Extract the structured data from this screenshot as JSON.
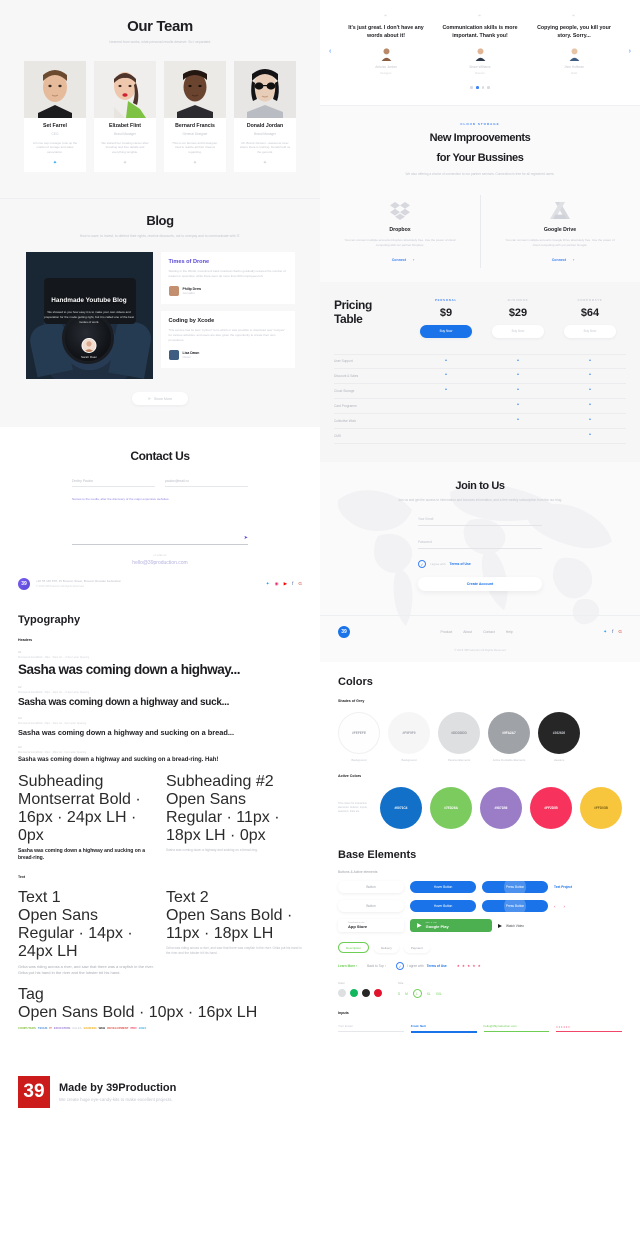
{
  "team": {
    "title": "Our Team",
    "subtitle": "I learned from works, what personal results\ndeserve. So I separated.",
    "members": [
      {
        "name": "Set Farrel",
        "role": "CEO",
        "desc": "A home cap manager took up the market of storage and sales association.",
        "social": "twitter-icon"
      },
      {
        "name": "Elizabet Flint",
        "role": "Brand Manager",
        "desc": "We started her creating career after founding and free details and everything tangible.",
        "social": "twitter-icon"
      },
      {
        "name": "Bernard Francis",
        "role": "General Designer",
        "desc": "This is our famous archit designer, tried to realize all their dreams regarding.",
        "social": "twitter-icon"
      },
      {
        "name": "Donald Jordan",
        "role": "Brand Manager",
        "desc": "Mr. Brand Jonston - awesome lover where there is training. Donald told us the general.",
        "social": "twitter-icon"
      }
    ]
  },
  "blog": {
    "title": "Blog",
    "subtitle": "How to save, to invest, to defend their\nrights, receive discounts, not to overpay\nand to communicate with IT.",
    "hero": {
      "title": "Handmade Youtube Blog",
      "desc": "We showed to you how easy it is to make your own videos and preparation for the mode getting right, but it is called one of the best modes of work.",
      "author": "Sarah Roan"
    },
    "posts": [
      {
        "title": "Times of Drone",
        "body": "Starting in the 2010s, investment bank Goldman Sachs gradually reduced the number of traders in securities, while there were de more than 600 employees left.",
        "author": "Philip Drew",
        "role": "Journalist"
      },
      {
        "title": "Coding by Xcode",
        "body": "This service has its best \"python\" form which in was possible to download new \"recipes\" for various activities, and users are also given the opportunity to create their own procedures.",
        "author": "Lisa Dawn",
        "role": "Owner"
      }
    ],
    "show_more": "Show More"
  },
  "contact": {
    "title": "Contact Us",
    "name_value": "Dmitry Paulov",
    "email_value": "paulov@mail.ru",
    "note": "Names to the media, after the discovery of the major expensive websites.",
    "message_placeholder": "",
    "send_icon": "send-icon",
    "or": "or write us",
    "email_link": "hello@39production.com",
    "address_line1": "+40 55 145 878, 15 Brooton Street, Brooton Russian Federation",
    "address_line2": "© 2018 39Production All Rights Reserved",
    "socials": [
      "twitter-icon",
      "instagram-icon",
      "youtube-icon",
      "facebook-icon",
      "google-plus-icon"
    ],
    "logo": "39"
  },
  "typography": {
    "title": "Typography",
    "headers_label": "Headers",
    "items": [
      {
        "tag": "H1",
        "meta": "Montserrat ExtraBold · 48px · 54px LH · -0.5px Letter Spacing",
        "text": "Sasha was coming down a highway...",
        "size": "h1s"
      },
      {
        "tag": "H2",
        "meta": "Montserrat ExtraBold · 36px · 44px LH · -0.3px Letter Spacing",
        "text": "Sasha was coming down a highway and suck...",
        "size": "h2s"
      },
      {
        "tag": "H3",
        "meta": "Montserrat ExtraBold · 26px · 34px LH · 0px Letter Spacing",
        "text": "Sasha was coming down a highway and sucking on a bread...",
        "size": "h3s"
      },
      {
        "tag": "H4",
        "meta": "Montserrat ExtraBold · 20px · 28px LH · 0px Letter Spacing",
        "text": "Sasha was coming down a highway and sucking on a bread-ring. Hah!",
        "size": "h4s"
      }
    ],
    "sub_left": {
      "label": "Subheading",
      "meta": "Montserrat Bold · 16px · 24px LH · 0px",
      "text": "Sasha was coming down a highway and sucking on a bread-ring."
    },
    "sub_right": {
      "label": "Subheading #2",
      "meta": "Open Sans Regular · 11px · 18px LH · 0px",
      "text": "Sasha was coming down a highway and sucking on a bread-ring."
    },
    "text_label": "Text",
    "text_left": {
      "label": "Text 1",
      "meta": "Open Sans Regular · 14px · 24px LH",
      "body": "Grika was riding across a river, and saw that there was a crayfish in the river. Grika put his hand in the river and the lobster bit his hand."
    },
    "text_right": {
      "label": "Text 2",
      "meta": "Open Sans Bold · 11px · 18px LH",
      "body": "Grika was riding across a river, and saw that there was crayfish in the river. Grika put his hand in the river and the lobster bit his hand."
    },
    "tag_label": "Tag",
    "tag_meta": "Open Sans Bold · 10px · 16px LH",
    "tags": [
      {
        "t": "COMPUTERS",
        "c": "#8bc34a"
      },
      {
        "t": "TECHS",
        "c": "#4a90d9"
      },
      {
        "t": "IT",
        "c": "#e2574c"
      },
      {
        "t": "EDUCATION",
        "c": "#9b7fd4"
      },
      {
        "t": "SALES",
        "c": "#cfd2d8"
      },
      {
        "t": "BANKING",
        "c": "#f0b429"
      },
      {
        "t": "WEB",
        "c": "#3a3a3a"
      },
      {
        "t": "DEVELOPMENT",
        "c": "#e2574c"
      },
      {
        "t": "PRO",
        "c": "#f2456a"
      },
      {
        "t": "JOBS",
        "c": "#4ab8e8"
      }
    ]
  },
  "madeby": {
    "logo": "39",
    "title": "Made by 39Production",
    "subtitle": "We create huge eye-candy-kits to make excellent projects."
  },
  "testimonials": {
    "prev_icon": "chevron-left-icon",
    "next_icon": "chevron-right-icon",
    "items": [
      {
        "quote": "It's just great. I don't have any words about it!",
        "name": "Antonio Jordan",
        "role": "Designer"
      },
      {
        "quote": "Communication skills is more important. Thank you!",
        "name": "Bruce Williams",
        "role": "Director"
      },
      {
        "quote": "Copying people, you kill your story. Sorry...",
        "name": "Jhon Hoffman",
        "role": "Artist"
      }
    ],
    "dots": [
      false,
      true,
      false,
      false
    ]
  },
  "cloud": {
    "eyebrow": "CLOUD STORAGE",
    "title_line1": "New Improovements",
    "title_line2": "for Your Bussines",
    "subtitle": "We also offering a choice of connection\nto our partner services. Connection is free\nfor all registered users.",
    "cards": [
      {
        "icon": "dropbox-icon",
        "title": "Dropbox",
        "desc": "You can connect multiple accounts Dropbox absolutely free. Use the power of cloud computing with our partner Dropbox.",
        "cta": "Connect",
        "cta_icon": "arrow-right-icon"
      },
      {
        "icon": "google-drive-icon",
        "title": "Google Drive",
        "desc": "You can connect multiple accounts Google Drive absolutely free. Use the power of cloud computing with our partner Google.",
        "cta": "Connect",
        "cta_icon": "arrow-right-icon"
      }
    ]
  },
  "pricing": {
    "title_line1": "Pricing",
    "title_line2": "Table",
    "plans": [
      {
        "tier": "PERSONAL",
        "price": "$9",
        "cta": "Buy Now",
        "active": true
      },
      {
        "tier": "BUSINESS",
        "price": "$29",
        "cta": "Buy Now",
        "active": false
      },
      {
        "tier": "CORPORATE",
        "price": "$64",
        "cta": "Buy Now",
        "active": false
      }
    ],
    "features": [
      {
        "name": "User Support",
        "cells": [
          true,
          true,
          true
        ]
      },
      {
        "name": "Discount & Sales",
        "cells": [
          true,
          true,
          true
        ]
      },
      {
        "name": "Cloud Storage",
        "cells": [
          true,
          true,
          true
        ]
      },
      {
        "name": "Card Programm",
        "cells": [
          false,
          true,
          true
        ]
      },
      {
        "name": "Collective Work",
        "cells": [
          false,
          true,
          true
        ]
      },
      {
        "name": "CMS",
        "cells": [
          false,
          false,
          true
        ]
      }
    ]
  },
  "join": {
    "title": "Join to Us",
    "subtitle": "Join us and get the access to information and\nbonuses information, and a free weekly subscription\nfrom the our blog.",
    "email_placeholder": "Your Email",
    "password_placeholder": "Password",
    "agree_text": "I agree with",
    "terms_link": "Terms of Use",
    "submit": "Create Account",
    "logo": "39",
    "nav": [
      "Product",
      "About",
      "Contact",
      "Help"
    ],
    "socials": [
      "twitter-icon",
      "facebook-icon",
      "google-plus-icon"
    ],
    "copyright": "© 2018 39Production All Rights Reserved"
  },
  "colors": {
    "title": "Colors",
    "grey_label": "Shades of Grey",
    "greys": [
      {
        "hex": "#FEFEFE",
        "cap": "Background",
        "bg": "#fefefe",
        "fg": "#9ea1a9",
        "border": true
      },
      {
        "hex": "#F9F9F9",
        "cap": "Background",
        "bg": "#f6f6f7",
        "fg": "#9ea1a9",
        "border": false
      },
      {
        "hex": "#DDDDDD",
        "cap": "Passive Elements",
        "bg": "#dedfe1",
        "fg": "#8b8e95",
        "border": false
      },
      {
        "hex": "#9FA2A7",
        "cap": "Active Dockable Elements",
        "bg": "#9fa2a7",
        "fg": "#ffffff",
        "border": false
      },
      {
        "hex": "#262626",
        "cap": "Headers",
        "bg": "#262626",
        "fg": "#c9ccd3",
        "border": false
      }
    ],
    "active_label": "Active Colors",
    "active_note": "This colors for interactive elements: buttons, inputs, selectors, links etc.",
    "actives": [
      {
        "hex": "#0071C4",
        "bg": "#1270c9"
      },
      {
        "hex": "#7ED26A",
        "bg": "#7ccb5f"
      },
      {
        "hex": "#9871B6",
        "bg": "#9a7cc7"
      },
      {
        "hex": "#FF2D55",
        "bg": "#f7335d"
      },
      {
        "hex": "#FFD03B",
        "bg": "#f7c63c"
      }
    ]
  },
  "base": {
    "title": "Base Elements",
    "buttons_label": "Buttons & Active elements",
    "row1": {
      "b1": "Button",
      "b2": "Hover Button",
      "b3": "Press Button",
      "link": "Text Project"
    },
    "row2": {
      "b1": "Button",
      "b2": "Hover Button",
      "b3": "Press Button",
      "prev": "chevron-left-icon",
      "next": "chevron-right-icon"
    },
    "appstore": {
      "small": "Download on the",
      "big": "App Store",
      "icon": "apple-icon"
    },
    "googleplay": {
      "small": "GET IT ON",
      "big": "Google Play",
      "icon": "play-icon"
    },
    "watch": {
      "label": "Watch Video",
      "icon": "play-triangle-icon"
    },
    "tabs": [
      {
        "label": "Description",
        "active": true
      },
      {
        "label": "Delivery",
        "active": false
      },
      {
        "label": "Payment",
        "active": false
      }
    ],
    "links": [
      {
        "label": "Learn More",
        "type": "green",
        "icon": "arrow-right-icon"
      },
      {
        "label": "Back to Top",
        "type": "grey",
        "icon": "arrow-up-icon"
      },
      {
        "label": "I agree with",
        "type": "grey",
        "icon": "check-circle-icon"
      },
      {
        "label": "Terms of Use",
        "type": "blue"
      }
    ],
    "stars": 5,
    "color_label": "Color",
    "color_balls": [
      "#dedfe1",
      "#12b65c",
      "#262626",
      "#e2142d"
    ],
    "size_label": "Size",
    "sizes": [
      "S",
      "M",
      "L",
      "XL",
      "XXL"
    ],
    "size_active": "L",
    "inputs_label": "Inputs",
    "inputs": [
      {
        "value": "Your Email",
        "state": "grey"
      },
      {
        "value": "From: Neil",
        "state": "blue"
      },
      {
        "value": "hello@39production.com",
        "state": "green",
        "icon": "arrow-right-icon"
      },
      {
        "value": "••••••",
        "state": "red"
      }
    ]
  }
}
